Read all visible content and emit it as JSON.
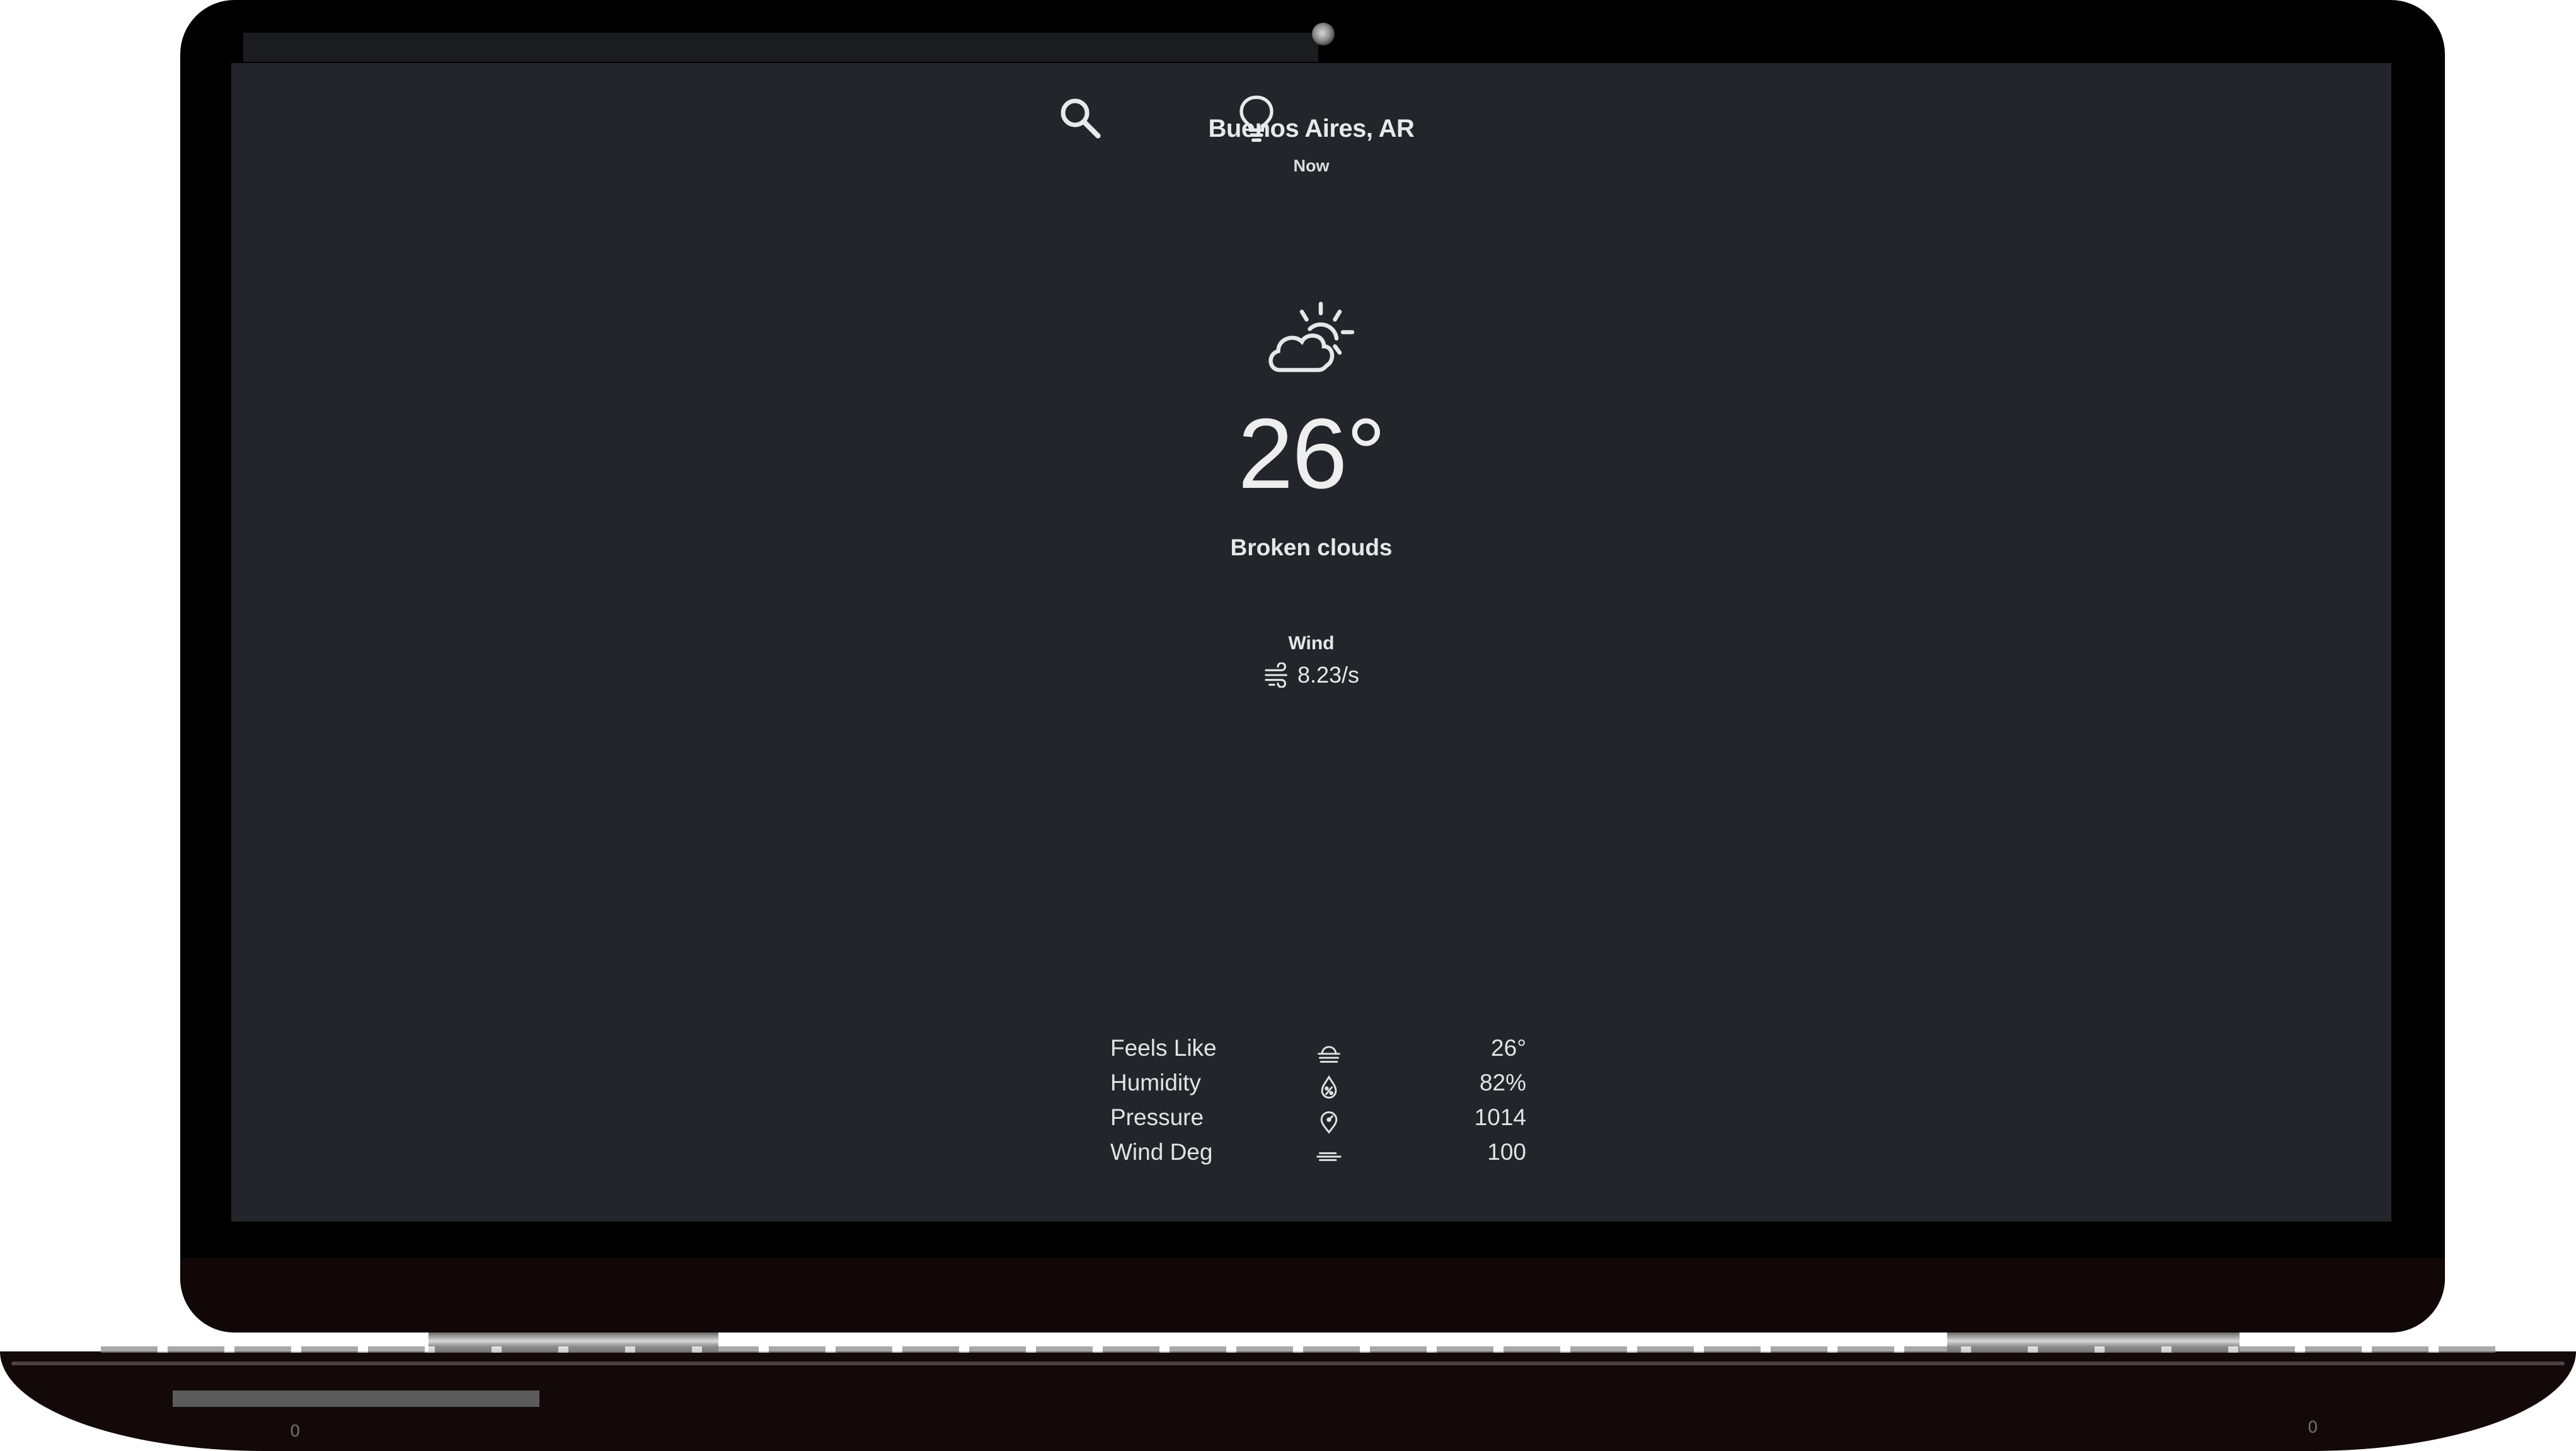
{
  "app": {
    "location": "Buenos Aires, AR",
    "time_label": "Now",
    "temperature": "26°",
    "condition": "Broken clouds",
    "condition_icon": "partly-cloudy-sun-icon",
    "wind": {
      "label": "Wind",
      "value": "8.23/s",
      "icon": "wind-icon"
    },
    "toolbar": {
      "search_icon": "search-icon",
      "theme_icon": "lightbulb-icon"
    },
    "details": [
      {
        "label": "Feels Like",
        "icon": "feels-like-icon",
        "value": "26°"
      },
      {
        "label": "Humidity",
        "icon": "humidity-drop-icon",
        "value": "82%"
      },
      {
        "label": "Pressure",
        "icon": "pressure-gauge-icon",
        "value": "1014"
      },
      {
        "label": "Wind Deg",
        "icon": "wind-direction-icon",
        "value": "100"
      }
    ]
  },
  "device": {
    "foot_left": "0",
    "foot_right": "0"
  },
  "colors": {
    "screen_background": "#222529",
    "text": "#e6e7e8",
    "bezel": "#000000",
    "base": "#140909"
  }
}
